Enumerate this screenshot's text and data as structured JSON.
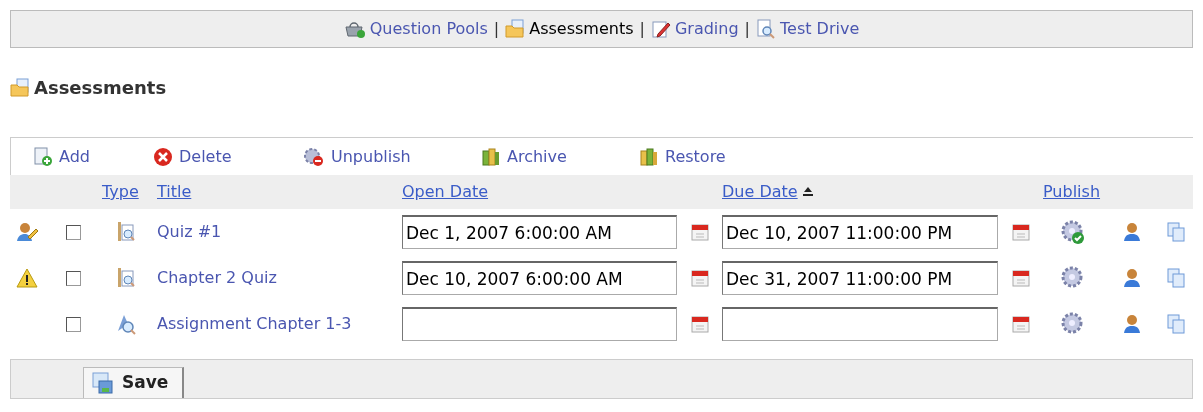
{
  "nav": [
    {
      "label": "Question Pools",
      "selected": false
    },
    {
      "label": "Assessments",
      "selected": true
    },
    {
      "label": "Grading",
      "selected": false
    },
    {
      "label": "Test Drive",
      "selected": false
    }
  ],
  "nav_separator": "|",
  "heading": "Assessments",
  "toolbar": [
    {
      "label": "Add"
    },
    {
      "label": "Delete"
    },
    {
      "label": "Unpublish"
    },
    {
      "label": "Archive"
    },
    {
      "label": "Restore"
    }
  ],
  "table": {
    "columns": [
      {
        "label": "Type",
        "sorted": false
      },
      {
        "label": "Title",
        "sorted": false
      },
      {
        "label": "Open Date",
        "sorted": false
      },
      {
        "label": "Due Date",
        "sorted": true
      },
      {
        "label": "Publish",
        "sorted": false
      }
    ],
    "rows": [
      {
        "in_progress": true,
        "warning": false,
        "checked": false,
        "kind": "quiz",
        "title": "Quiz #1",
        "open_date": "Dec 1, 2007 6:00:00 AM",
        "due_date": "Dec 10, 2007 11:00:00 PM",
        "published": true
      },
      {
        "in_progress": false,
        "warning": true,
        "checked": false,
        "kind": "quiz",
        "title": "Chapter 2 Quiz",
        "open_date": "Dec 10, 2007 6:00:00 AM",
        "due_date": "Dec 31, 2007 11:00:00 PM",
        "published": false
      },
      {
        "in_progress": false,
        "warning": false,
        "checked": false,
        "kind": "assignment",
        "title": "Assignment Chapter 1-3",
        "published": false
      }
    ]
  },
  "save_button": "Save"
}
